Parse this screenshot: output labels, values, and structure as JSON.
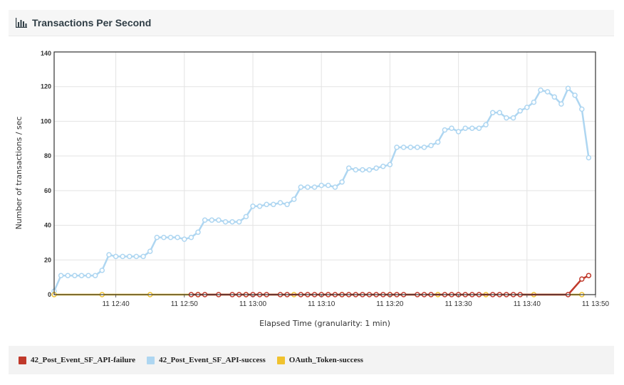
{
  "panel": {
    "title": "Transactions Per Second"
  },
  "chart_data": {
    "type": "line",
    "title": "Transactions Per Second",
    "xlabel": "Elapsed Time (granularity: 1 min)",
    "ylabel": "Number of transactions / sec",
    "ylim": [
      0,
      140
    ],
    "yticks": [
      0,
      20,
      40,
      60,
      80,
      100,
      120,
      140
    ],
    "x_unit": "minutes",
    "xlim": [
      "11 12:31",
      "11 13:50"
    ],
    "xticks": [
      {
        "label": "11 12:40",
        "time": "11 12:40"
      },
      {
        "label": "11 12:50",
        "time": "11 12:50"
      },
      {
        "label": "11 13:00",
        "time": "11 13:00"
      },
      {
        "label": "11 13:10",
        "time": "11 13:10"
      },
      {
        "label": "11 13:20",
        "time": "11 13:20"
      },
      {
        "label": "11 13:30",
        "time": "11 13:30"
      },
      {
        "label": "11 13:40",
        "time": "11 13:40"
      },
      {
        "label": "11 13:50",
        "time": "11 13:50"
      }
    ],
    "grid": true,
    "legend_position": "bottom",
    "series": [
      {
        "name": "42_Post_Event_SF_API-failure",
        "color": "#c0392b",
        "x": [
          "11 12:51",
          "11 12:52",
          "11 12:53",
          "11 12:55",
          "11 12:57",
          "11 12:58",
          "11 12:59",
          "11 13:00",
          "11 13:01",
          "11 13:02",
          "11 13:04",
          "11 13:05",
          "11 13:07",
          "11 13:08",
          "11 13:09",
          "11 13:10",
          "11 13:11",
          "11 13:12",
          "11 13:13",
          "11 13:14",
          "11 13:15",
          "11 13:16",
          "11 13:17",
          "11 13:18",
          "11 13:19",
          "11 13:20",
          "11 13:21",
          "11 13:22",
          "11 13:24",
          "11 13:25",
          "11 13:26",
          "11 13:28",
          "11 13:29",
          "11 13:30",
          "11 13:31",
          "11 13:32",
          "11 13:33",
          "11 13:35",
          "11 13:36",
          "11 13:37",
          "11 13:38",
          "11 13:39",
          "11 13:46",
          "11 13:48",
          "11 13:49"
        ],
        "values": [
          0,
          0,
          0,
          0,
          0,
          0,
          0,
          0,
          0,
          0,
          0,
          0,
          0,
          0,
          0,
          0,
          0,
          0,
          0,
          0,
          0,
          0,
          0,
          0,
          0,
          0,
          0,
          0,
          0,
          0,
          0,
          0,
          0,
          0,
          0,
          0,
          0,
          0,
          0,
          0,
          0,
          0,
          0,
          9,
          11
        ]
      },
      {
        "name": "42_Post_Event_SF_API-success",
        "color": "#aed6f1",
        "x": [
          "11 12:31",
          "11 12:32",
          "11 12:33",
          "11 12:34",
          "11 12:35",
          "11 12:36",
          "11 12:37",
          "11 12:38",
          "11 12:39",
          "11 12:40",
          "11 12:41",
          "11 12:42",
          "11 12:43",
          "11 12:44",
          "11 12:45",
          "11 12:46",
          "11 12:47",
          "11 12:48",
          "11 12:49",
          "11 12:50",
          "11 12:51",
          "11 12:52",
          "11 12:53",
          "11 12:54",
          "11 12:55",
          "11 12:56",
          "11 12:57",
          "11 12:58",
          "11 12:59",
          "11 13:00",
          "11 13:01",
          "11 13:02",
          "11 13:03",
          "11 13:04",
          "11 13:05",
          "11 13:06",
          "11 13:07",
          "11 13:08",
          "11 13:09",
          "11 13:10",
          "11 13:11",
          "11 13:12",
          "11 13:13",
          "11 13:14",
          "11 13:15",
          "11 13:16",
          "11 13:17",
          "11 13:18",
          "11 13:19",
          "11 13:20",
          "11 13:21",
          "11 13:22",
          "11 13:23",
          "11 13:24",
          "11 13:25",
          "11 13:26",
          "11 13:27",
          "11 13:28",
          "11 13:29",
          "11 13:30",
          "11 13:31",
          "11 13:32",
          "11 13:33",
          "11 13:34",
          "11 13:35",
          "11 13:36",
          "11 13:37",
          "11 13:38",
          "11 13:39",
          "11 13:40",
          "11 13:41",
          "11 13:42",
          "11 13:43",
          "11 13:44",
          "11 13:45",
          "11 13:46",
          "11 13:47",
          "11 13:48",
          "11 13:49"
        ],
        "values": [
          2,
          11,
          11,
          11,
          11,
          11,
          11,
          14,
          23,
          22,
          22,
          22,
          22,
          22,
          25,
          33,
          33,
          33,
          33,
          32,
          33,
          36,
          43,
          43,
          43,
          42,
          42,
          42,
          45,
          51,
          51,
          52,
          52,
          53,
          52,
          55,
          62,
          62,
          62,
          63,
          63,
          62,
          65,
          73,
          72,
          72,
          72,
          73,
          74,
          75,
          85,
          85,
          85,
          85,
          85,
          86,
          88,
          95,
          96,
          94,
          96,
          96,
          96,
          98,
          105,
          105,
          102,
          102,
          106,
          108,
          111,
          118,
          117,
          114,
          110,
          119,
          115,
          107,
          79
        ]
      },
      {
        "name": "OAuth_Token-success",
        "color": "#f0c22e",
        "x": [
          "11 12:31",
          "11 12:38",
          "11 12:45",
          "11 12:52",
          "11 12:59",
          "11 13:06",
          "11 13:13",
          "11 13:20",
          "11 13:27",
          "11 13:34",
          "11 13:41",
          "11 13:48"
        ],
        "values": [
          0,
          0,
          0,
          0,
          0,
          0,
          0,
          0,
          0,
          0,
          0,
          0
        ]
      }
    ]
  },
  "legend": {
    "items": [
      {
        "label": "42_Post_Event_SF_API-failure",
        "color": "#c0392b"
      },
      {
        "label": "42_Post_Event_SF_API-success",
        "color": "#aed6f1"
      },
      {
        "label": "OAuth_Token-success",
        "color": "#f0c22e"
      }
    ]
  }
}
